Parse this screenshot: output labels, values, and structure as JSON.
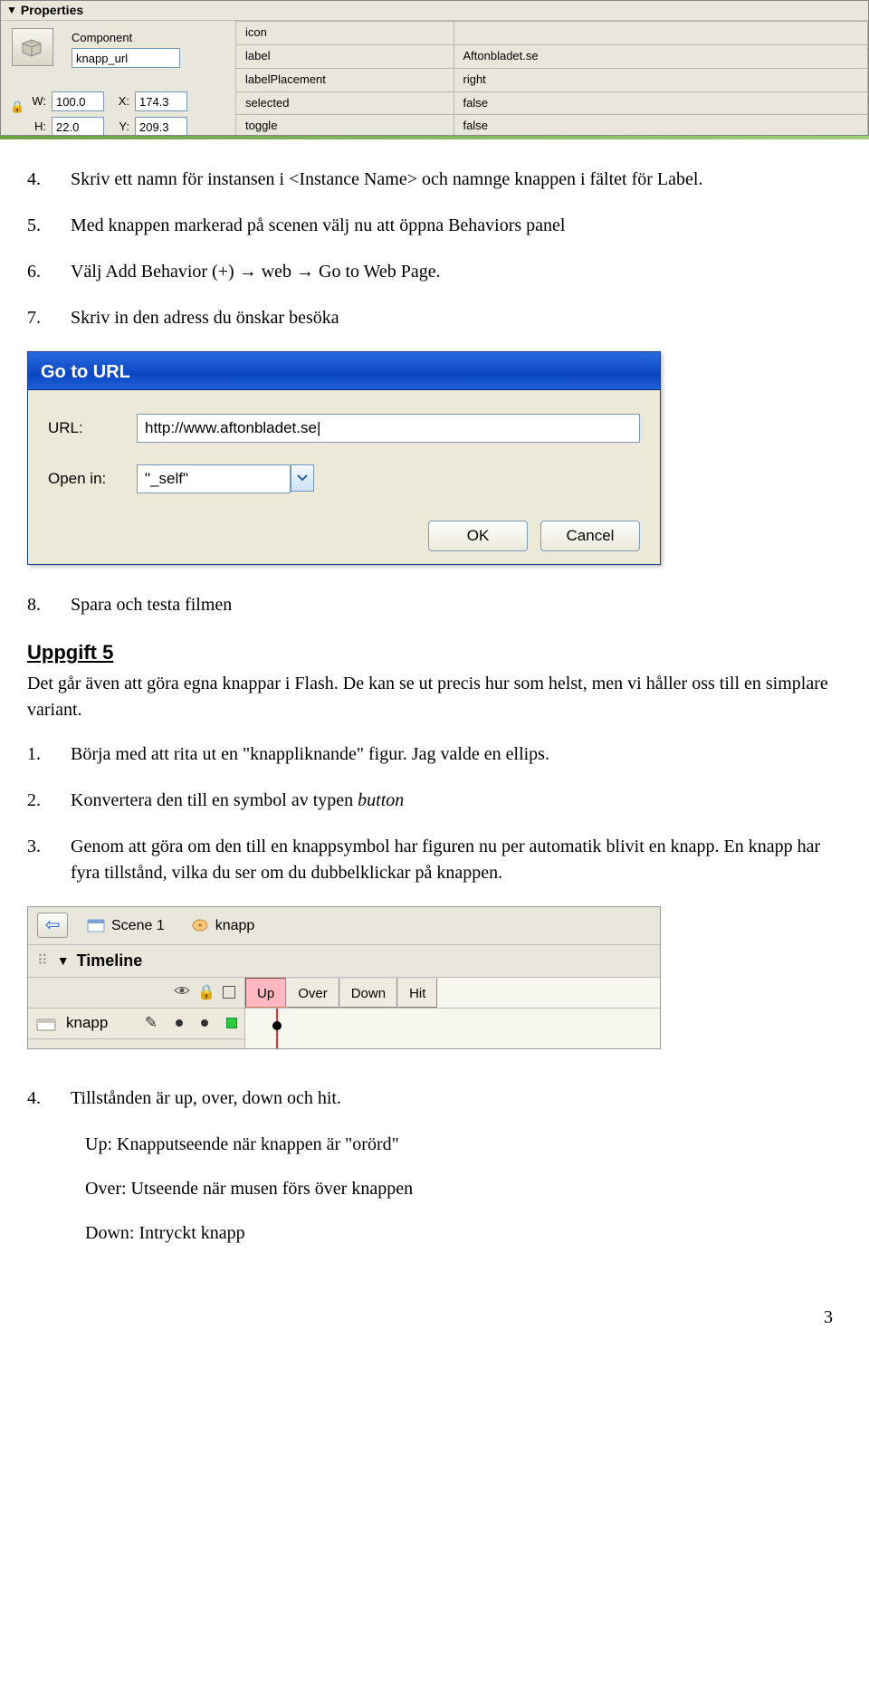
{
  "props": {
    "panel_title": "Properties",
    "component_label": "Component",
    "component_name": "knapp_url",
    "W_label": "W:",
    "W_val": "100.0",
    "H_label": "H:",
    "H_val": "22.0",
    "X_label": "X:",
    "X_val": "174.3",
    "Y_label": "Y:",
    "Y_val": "209.3",
    "kv": [
      {
        "k": "icon",
        "v": ""
      },
      {
        "k": "label",
        "v": "Aftonbladet.se"
      },
      {
        "k": "labelPlacement",
        "v": "right"
      },
      {
        "k": "selected",
        "v": "false"
      },
      {
        "k": "toggle",
        "v": "false"
      }
    ]
  },
  "steps_a": [
    {
      "n": "4.",
      "t": "Skriv ett namn för instansen i <Instance Name> och namnge knappen i fältet för Label."
    },
    {
      "n": "5.",
      "t": "Med knappen markerad på scenen välj nu att öppna Behaviors panel"
    },
    {
      "n": "6.",
      "t_pre": "Välj Add Behavior (+) ",
      "t_a1": "→",
      "t_mid": " web ",
      "t_a2": "→",
      "t_post": " Go to Web Page."
    },
    {
      "n": "7.",
      "t": "Skriv in den adress du önskar besöka"
    }
  ],
  "dlg": {
    "title": "Go to URL",
    "url_label": "URL:",
    "url_value": "http://www.aftonbladet.se|",
    "open_label": "Open in:",
    "open_value": "\"_self\"",
    "ok": "OK",
    "cancel": "Cancel"
  },
  "after_dlg": {
    "n": "8.",
    "t": "Spara och testa filmen"
  },
  "uppgift": {
    "title": "Uppgift 5",
    "intro": "Det går även att göra egna knappar i Flash. De kan se ut precis hur som helst, men vi håller oss till en simplare variant."
  },
  "steps_b": [
    {
      "n": "1.",
      "t": "Börja med att rita ut en \"knappliknande\" figur. Jag valde en ellips."
    },
    {
      "n": "2.",
      "t_pre": "Konvertera den till en symbol av typen ",
      "t_em": "button"
    },
    {
      "n": "3.",
      "t": "Genom att göra om den till en knappsymbol har figuren nu per automatik blivit en knapp. En knapp har fyra tillstånd, vilka du ser om du dubbelklickar på knappen."
    }
  ],
  "timeline": {
    "scene": "Scene 1",
    "symbol": "knapp",
    "panel": "Timeline",
    "states": [
      "Up",
      "Over",
      "Down",
      "Hit"
    ],
    "layer": "knapp"
  },
  "step4": {
    "n": "4.",
    "t": "Tillstånden är up, over, down och hit."
  },
  "states_desc": {
    "up": "Up: Knapputseende när knappen är \"orörd\"",
    "over": "Over: Utseende när musen förs över knappen",
    "down": "Down: Intryckt knapp"
  },
  "page_number": "3"
}
